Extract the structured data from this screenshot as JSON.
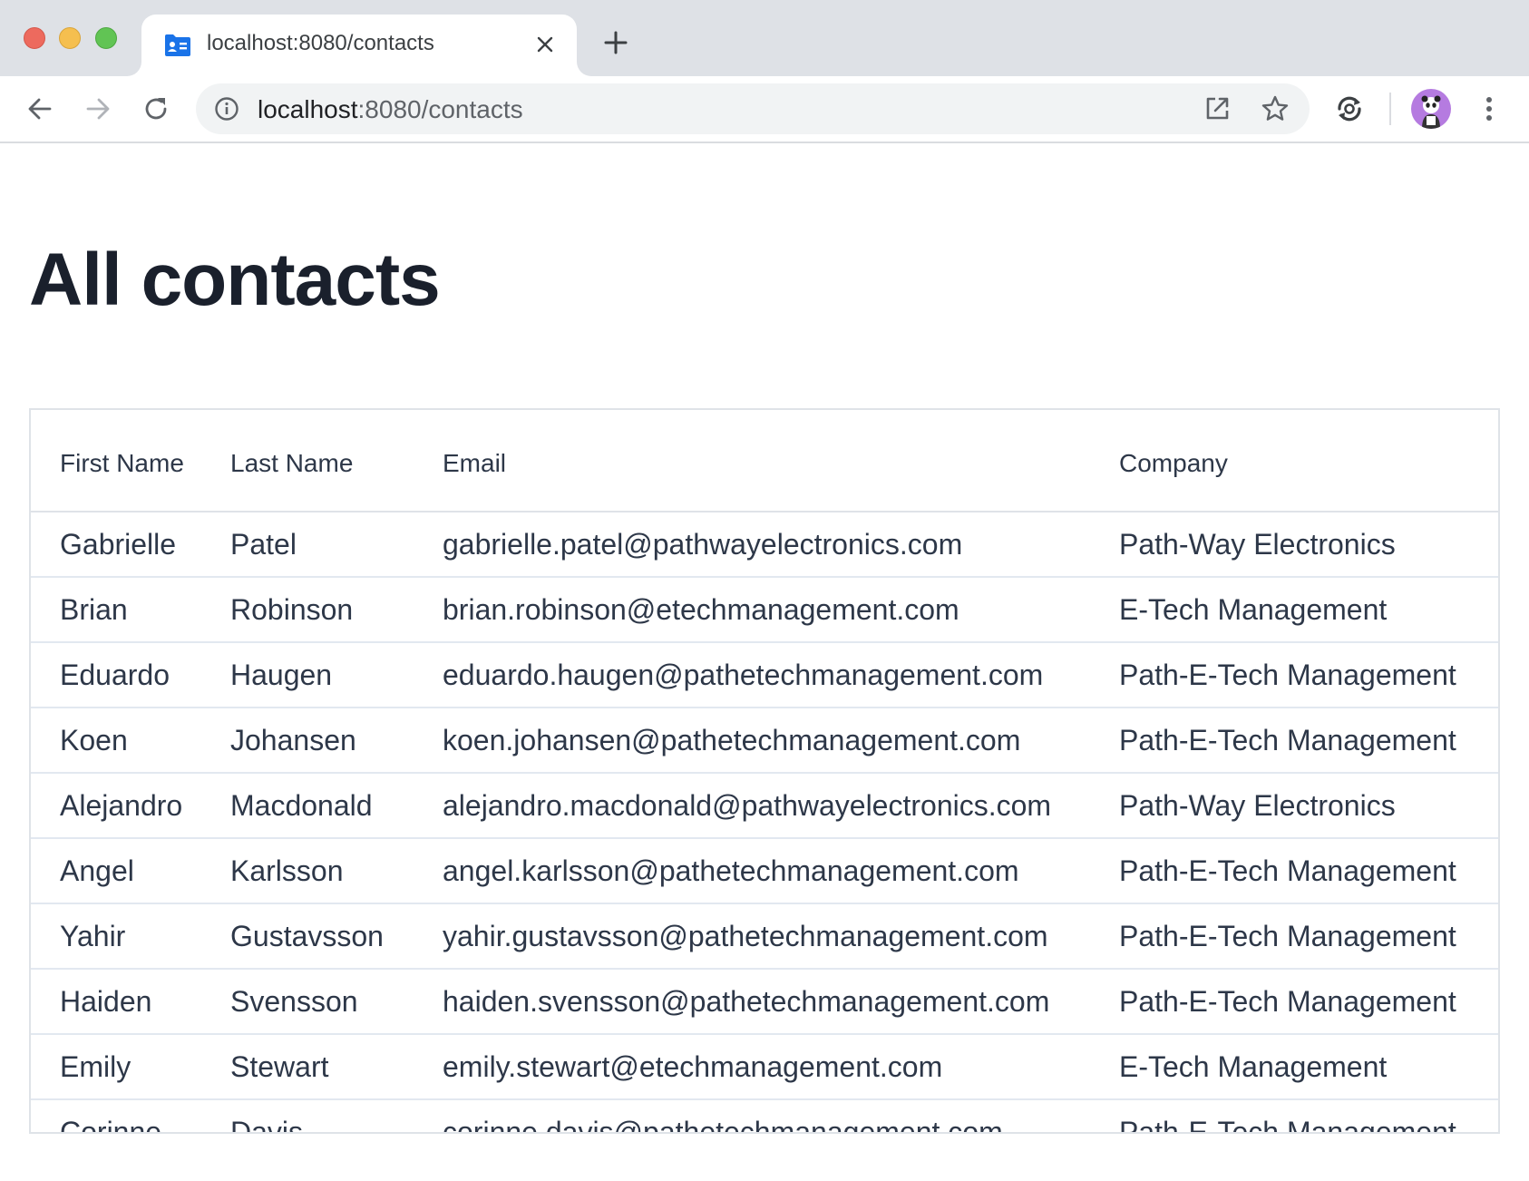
{
  "browser": {
    "tab": {
      "title": "localhost:8080/contacts",
      "favicon": "contact-card-icon"
    },
    "address": {
      "host": "localhost",
      "path": ":8080/contacts"
    },
    "icons": {
      "back": "back-arrow-icon",
      "forward": "forward-arrow-icon",
      "reload": "reload-icon",
      "info": "info-icon",
      "open_external": "open-in-new-window-icon",
      "bookmark": "star-icon",
      "extension": "extension-sync-icon",
      "menu": "kebab-menu-icon"
    },
    "colors": {
      "tabstrip": "#dee1e6",
      "omnibox": "#f1f3f4",
      "avatar_bg": "#b57be0",
      "favicon": "#1a73e8"
    }
  },
  "page": {
    "title": "All contacts"
  },
  "contacts_table": {
    "columns": [
      "First Name",
      "Last Name",
      "Email",
      "Company"
    ],
    "rows": [
      {
        "first": "Gabrielle",
        "last": "Patel",
        "email": "gabrielle.patel@pathwayelectronics.com",
        "company": "Path-Way Electronics"
      },
      {
        "first": "Brian",
        "last": "Robinson",
        "email": "brian.robinson@etechmanagement.com",
        "company": "E-Tech Management"
      },
      {
        "first": "Eduardo",
        "last": "Haugen",
        "email": "eduardo.haugen@pathetechmanagement.com",
        "company": "Path-E-Tech Management"
      },
      {
        "first": "Koen",
        "last": "Johansen",
        "email": "koen.johansen@pathetechmanagement.com",
        "company": "Path-E-Tech Management"
      },
      {
        "first": "Alejandro",
        "last": "Macdonald",
        "email": "alejandro.macdonald@pathwayelectronics.com",
        "company": "Path-Way Electronics"
      },
      {
        "first": "Angel",
        "last": "Karlsson",
        "email": "angel.karlsson@pathetechmanagement.com",
        "company": "Path-E-Tech Management"
      },
      {
        "first": "Yahir",
        "last": "Gustavsson",
        "email": "yahir.gustavsson@pathetechmanagement.com",
        "company": "Path-E-Tech Management"
      },
      {
        "first": "Haiden",
        "last": "Svensson",
        "email": "haiden.svensson@pathetechmanagement.com",
        "company": "Path-E-Tech Management"
      },
      {
        "first": "Emily",
        "last": "Stewart",
        "email": "emily.stewart@etechmanagement.com",
        "company": "E-Tech Management"
      },
      {
        "first": "Corinne",
        "last": "Davis",
        "email": "corinne.davis@pathetechmanagement.com",
        "company": "Path-E-Tech Management"
      }
    ]
  }
}
